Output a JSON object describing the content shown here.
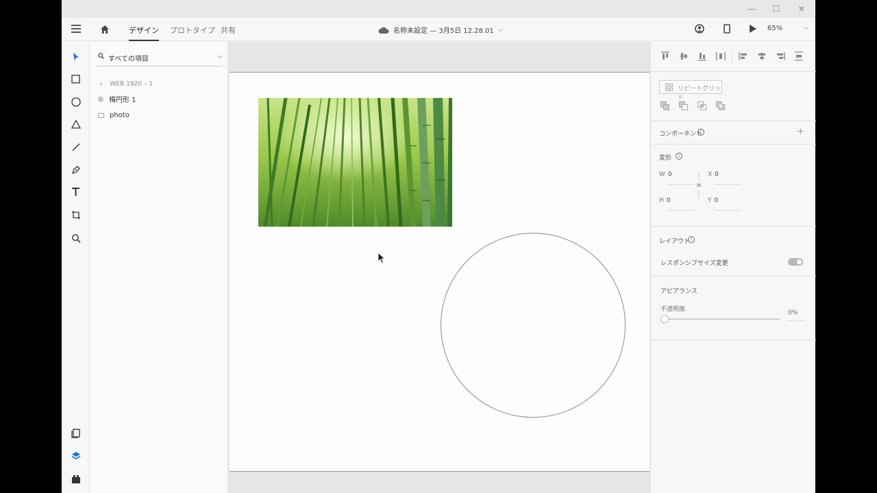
{
  "header": {
    "tabs": [
      {
        "label": "デザイン",
        "active": true
      },
      {
        "label": "プロトタイプ",
        "active": false
      },
      {
        "label": "共有",
        "active": false
      }
    ],
    "doc_title": "名称未設定 — 3月5日 12.28.01",
    "zoom": "65%"
  },
  "layers": {
    "search_placeholder": "すべての項目",
    "breadcrumb": "WEB 1920 – 1",
    "items": [
      {
        "label": "楕円形 1",
        "icon": "ellipse-layer-icon"
      },
      {
        "label": "photo",
        "icon": "image-layer-icon"
      }
    ]
  },
  "properties": {
    "repeat_grid": "リピートグリッド",
    "component": "コンポーネント",
    "transform": "変形",
    "w_label": "W",
    "w_value": "0",
    "h_label": "H",
    "h_value": "0",
    "x_label": "X",
    "x_value": "0",
    "y_label": "Y",
    "y_value": "0",
    "layout": "レイアウト",
    "responsive": "レスポンシブサイズ変更",
    "appearance": "アピアランス",
    "opacity_label": "不透明度",
    "opacity_value": "0%"
  },
  "colors": {
    "accent": "#1473e6",
    "canvas": "#e6e6e6"
  }
}
